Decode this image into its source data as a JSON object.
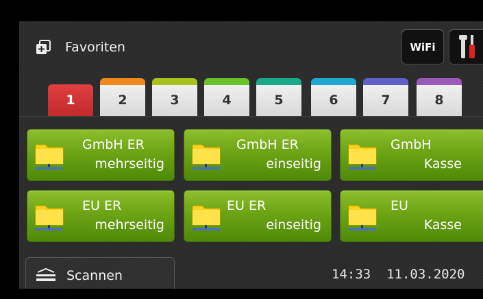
{
  "header": {
    "title": "Favoriten",
    "wifi_label": "WiFi",
    "favorites_icon": "favorites-plus-icon",
    "tools_icon": "tools-icon"
  },
  "tabs": [
    {
      "label": "1",
      "color": "#e04040",
      "active": true
    },
    {
      "label": "2",
      "color": "#f08a1c"
    },
    {
      "label": "3",
      "color": "#a8c21e"
    },
    {
      "label": "4",
      "color": "#6ac22a"
    },
    {
      "label": "5",
      "color": "#1aaa8a"
    },
    {
      "label": "6",
      "color": "#20a8d0"
    },
    {
      "label": "7",
      "color": "#6060c8"
    },
    {
      "label": "8",
      "color": "#9a5ab8"
    }
  ],
  "shortcuts": [
    {
      "line1": "GmbH ER",
      "line2": "mehrseitig"
    },
    {
      "line1": "GmbH ER",
      "line2": "einseitig"
    },
    {
      "line1": "GmbH",
      "line2": "Kasse"
    },
    {
      "line1": "EU ER",
      "line2": "mehrseitig"
    },
    {
      "line1": "EU ER",
      "line2": "einseitig"
    },
    {
      "line1": "EU",
      "line2": "Kasse"
    }
  ],
  "footer": {
    "scan_label": "Scannen",
    "time": "14:33",
    "date": "11.03.2020"
  },
  "colors": {
    "tile_green": "#6ca415",
    "background": "#2a2a2a",
    "active_tab": "#e04040"
  }
}
